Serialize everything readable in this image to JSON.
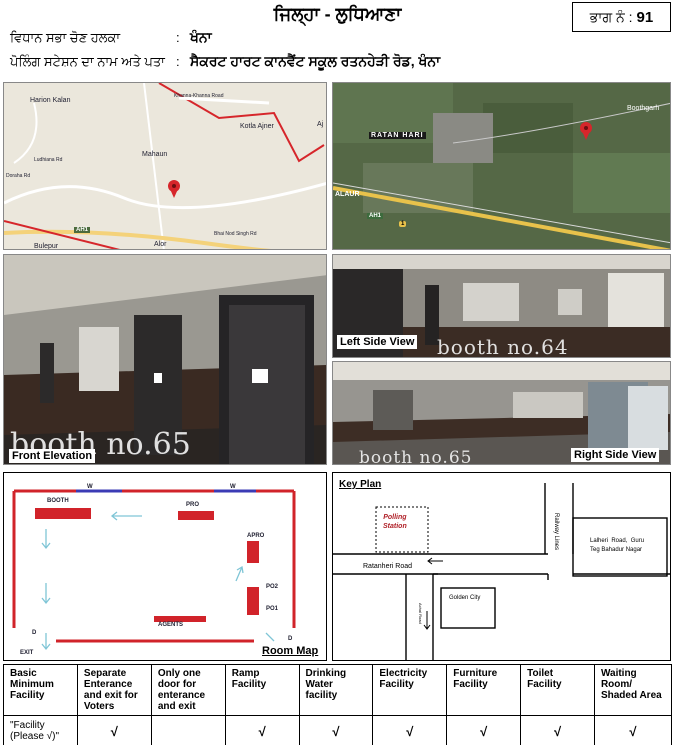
{
  "header": {
    "district": "ਜਿਲ੍ਹਾ - ਲੁਧਿਆਣਾ",
    "part_label": "ਭਾਗ ਨੰ :",
    "part_number": "91",
    "constituency_label": "ਵਿਧਾਨ ਸਭਾ ਚੋਣ ਹਲਕਾ",
    "constituency_sep": ":",
    "constituency_value": "ਖੰਨਾ",
    "station_label": "ਪੋਲਿੰਗ ਸਟੇਸ਼ਨ ਦਾ ਨਾਮ ਅਤੇ ਪਤਾ",
    "station_sep": ":",
    "station_value": "ਸੈਕਰਟ ਹਾਰਟ ਕਾਨਵੈਂਟ ਸਕੂਲ ਰਤਨਹੇੜੀ ਰੋਡ, ਖੰਨਾ"
  },
  "road_map": {
    "labels": [
      "Harion Kalan",
      "Mahaun",
      "Kotla Ajner",
      "Khanna-Khanna Road",
      "Aj",
      "Ludhiana Rd",
      "Doraha Rd",
      "AH1",
      "Bulepur",
      "Alor",
      "Bhai Nod Singh Rd"
    ]
  },
  "sat_map": {
    "labels": [
      "RATAN HARI",
      "Boothgarh",
      "ALAUR",
      "AH1",
      "1"
    ]
  },
  "photos": {
    "front_label": "Front Elevation",
    "front_watermark": "booth no.65",
    "left_label": "Left Side View",
    "left_watermark": "booth no.64",
    "right_label": "Right Side View",
    "right_watermark": "booth no.65"
  },
  "room_map": {
    "title": "Room Map",
    "labels": {
      "w1": "W",
      "w2": "W",
      "booth": "BOOTH",
      "pro": "PRO",
      "apro": "APRO",
      "po2": "PO2",
      "po1": "PO1",
      "agents": "AGENTS",
      "d1": "D",
      "d2": "D",
      "exit": "EXIT"
    }
  },
  "key_plan": {
    "title": "Key Plan",
    "polling_station": "Polling\nStation",
    "railway": "Railway Lines",
    "lalheri": "Lalheri  Road,  Guru\nTeg Bahadur Nagar",
    "ratanheri": "Ratanheri Road",
    "golden": "Golden City",
    "achal": "Achal Road"
  },
  "facilities": {
    "headers": [
      "Basic\nMinimum\nFacility",
      "Separate\nEnterance\nand exit for\nVoters",
      "Only one\ndoor for\nenterance\nand exit",
      "Ramp\nFacility",
      "Drinking\nWater\nfacility",
      "Electricity\nFacility",
      "Furniture\nFacility",
      "Toilet\nFacility",
      "Waiting\nRoom/\nShaded Area"
    ],
    "row_label": "\"Facility\n(Please √)\"",
    "values": [
      "√",
      "",
      "√",
      "√",
      "√",
      "√",
      "√",
      "√"
    ]
  }
}
